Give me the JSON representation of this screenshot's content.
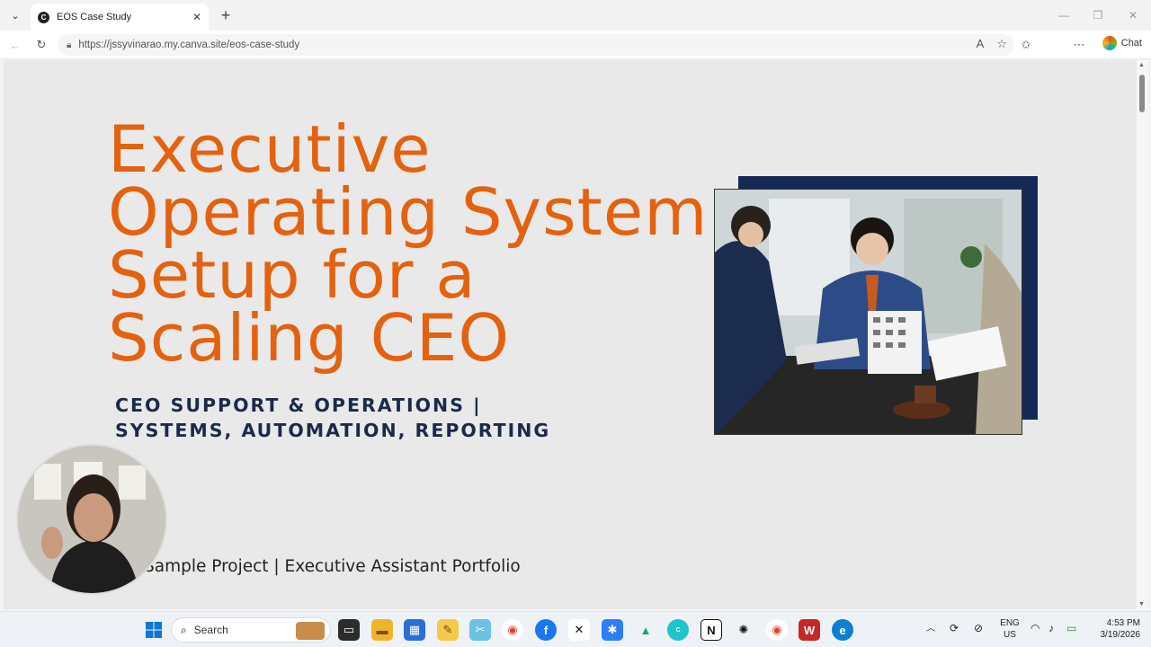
{
  "browser": {
    "tab_title": "EOS Case Study",
    "tab_close": "✕",
    "new_tab": "+",
    "url": "https://jssyvinarao.my.canva.site/eos-case-study",
    "chat_label": "Chat",
    "window_controls": [
      "—",
      "❐",
      "✕"
    ]
  },
  "page": {
    "title_lines": [
      "Executive",
      "Operating System",
      "Setup for a",
      "Scaling CEO"
    ],
    "subtitle": "CEO SUPPORT & OPERATIONS | SYSTEMS, AUTOMATION, REPORTING",
    "portfolio_line": "Sample Project | Executive Assistant Portfolio",
    "accent_color": "#e4620f",
    "navy_color": "#142a55"
  },
  "taskbar": {
    "search_label": "Search",
    "language": "ENG",
    "region": "US",
    "time": "4:53 PM",
    "date": "3/19/2026"
  }
}
